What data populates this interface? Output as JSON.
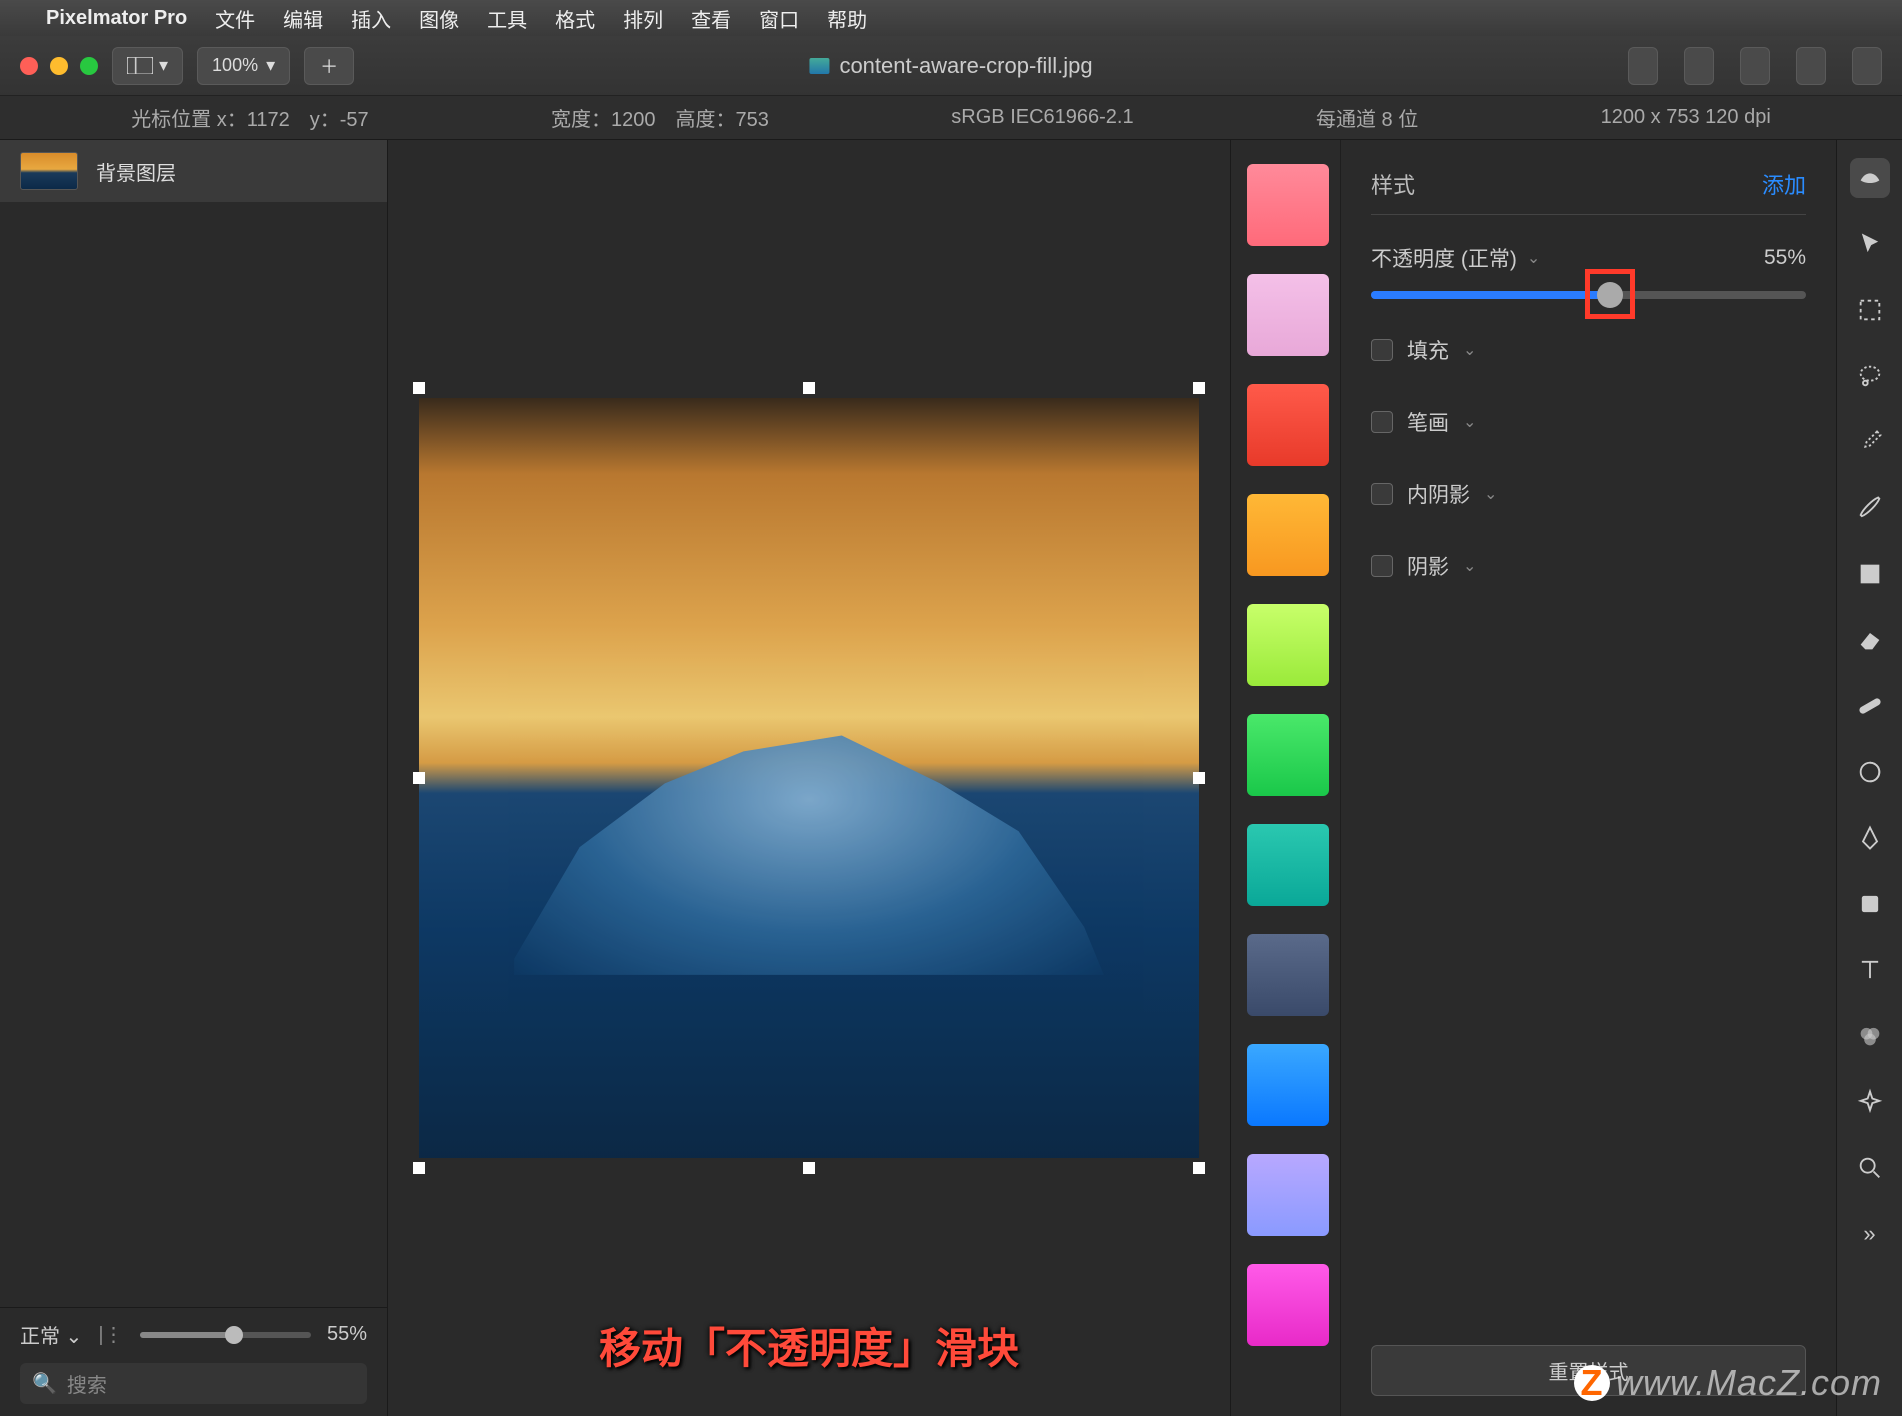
{
  "menubar": {
    "app": "Pixelmator Pro",
    "items": [
      "文件",
      "编辑",
      "插入",
      "图像",
      "工具",
      "格式",
      "排列",
      "查看",
      "窗口",
      "帮助"
    ]
  },
  "toolbar": {
    "zoom": "100%",
    "title": "content-aware-crop-fill.jpg"
  },
  "infobar": {
    "cursor_label": "光标位置 x：",
    "cursor_x": "1172",
    "cursor_y_label": "y：",
    "cursor_y": "-57",
    "width_label": "宽度：",
    "width": "1200",
    "height_label": "高度：",
    "height": "753",
    "colorspace": "sRGB IEC61966-2.1",
    "channel": "每通道 8 位",
    "dims": "1200 x 753 120 dpi"
  },
  "layers": {
    "item": "背景图层",
    "blend": "正常",
    "opacity": "55%",
    "search_ph": "搜索"
  },
  "canvas": {
    "caption": "移动「不透明度」滑块"
  },
  "styles": {
    "header": "样式",
    "add": "添加",
    "opacity_label": "不透明度 (正常)",
    "opacity_pct": "55%",
    "opacity_val": 55,
    "sections": {
      "fill": "填充",
      "stroke": "笔画",
      "inner": "内阴影",
      "shadow": "阴影"
    },
    "reset": "重置样式"
  },
  "swatches": [
    "linear-gradient(#ff8a9a,#ff6a7a)",
    "linear-gradient(#f4c0e8,#e8a8d8)",
    "linear-gradient(#ff5a4a,#e83a2a)",
    "linear-gradient(#ffb836,#f89820)",
    "linear-gradient(#c8ff6a,#9aea3a)",
    "linear-gradient(#4ae86a,#1ac84a)",
    "linear-gradient(#2ac8b0,#0aa898)",
    "linear-gradient(#5a6a8a,#3a4a6a)",
    "linear-gradient(#3aa8ff,#0a78ff)",
    "linear-gradient(#b8a8ff,#8a9aff)",
    "linear-gradient(#ff5ae8,#e82ac8)"
  ],
  "watermark": "www.MacZ.com"
}
